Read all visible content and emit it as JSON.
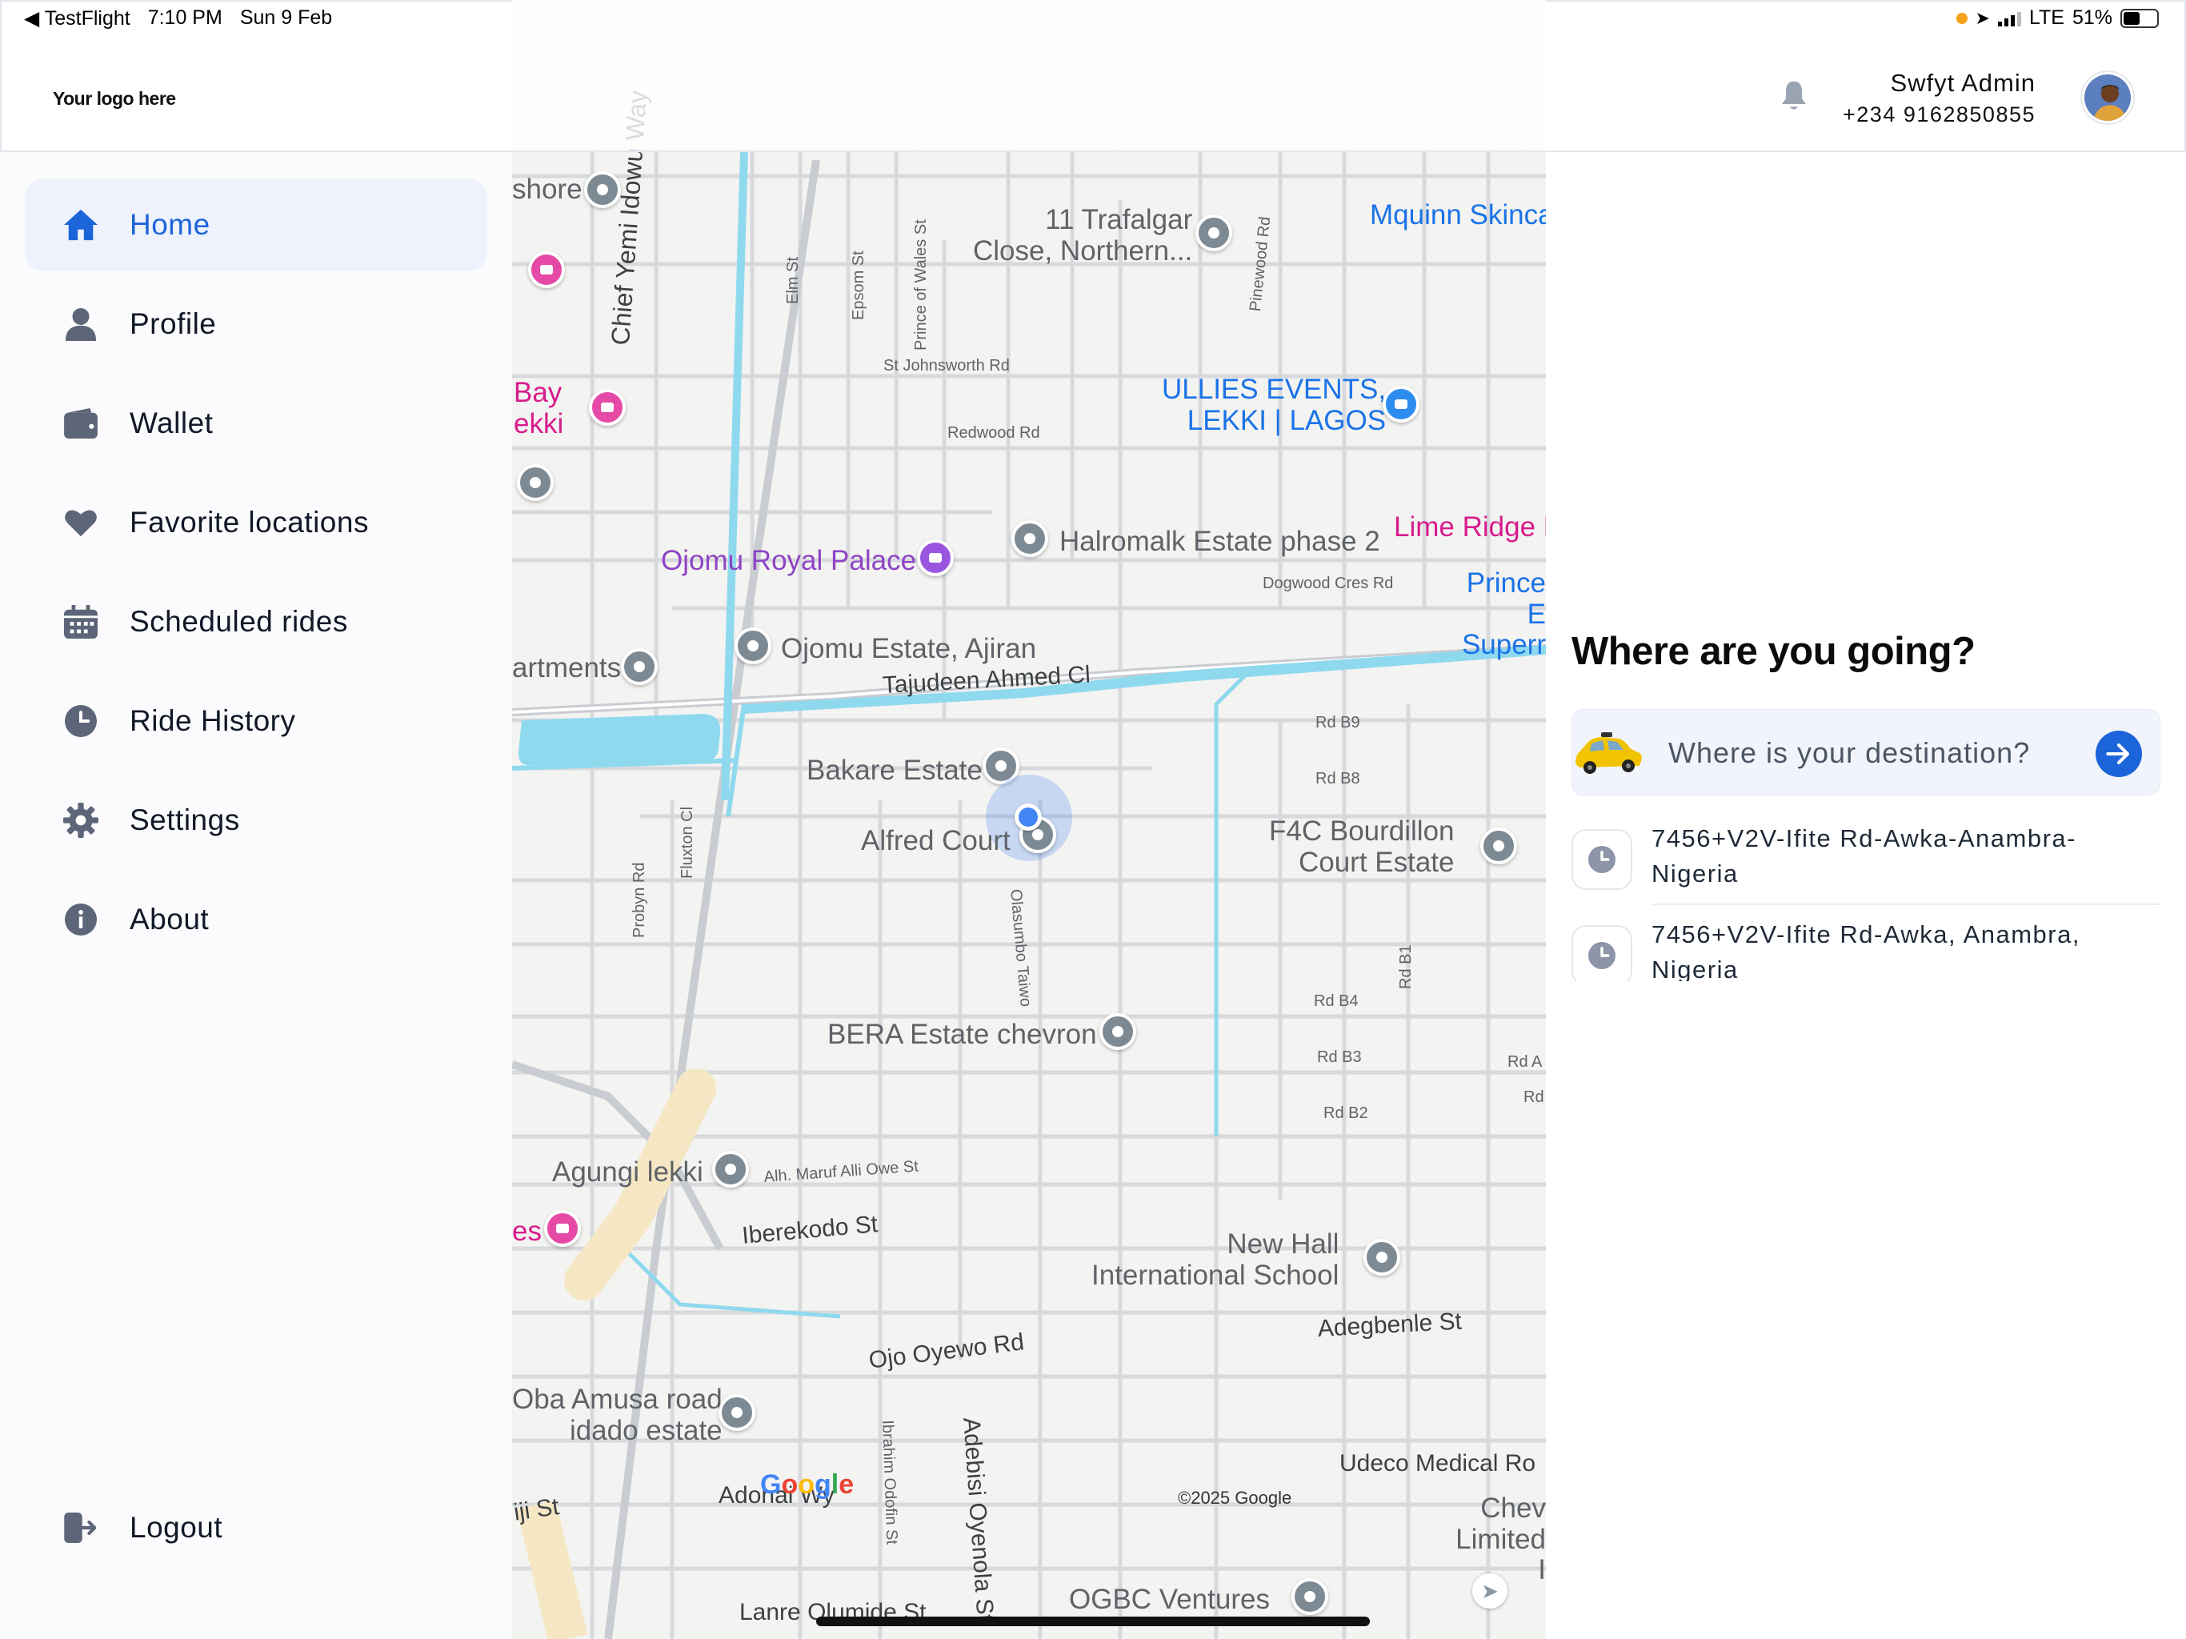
{
  "status_bar": {
    "back_app": "◀ TestFlight",
    "time": "7:10 PM",
    "date": "Sun 9 Feb",
    "network": "LTE",
    "battery": "51%",
    "battery_level": 0.51
  },
  "header": {
    "logo_text": "Your logo here",
    "user_name": "Swfyt Admin",
    "user_phone": "+234 9162850855"
  },
  "sidebar": {
    "items": [
      {
        "label": "Home",
        "icon": "home-icon",
        "active": true
      },
      {
        "label": "Profile",
        "icon": "user-icon",
        "active": false
      },
      {
        "label": "Wallet",
        "icon": "wallet-icon",
        "active": false
      },
      {
        "label": "Favorite locations",
        "icon": "heart-icon",
        "active": false
      },
      {
        "label": "Scheduled rides",
        "icon": "calendar-icon",
        "active": false
      },
      {
        "label": "Ride History",
        "icon": "clock-icon",
        "active": false
      },
      {
        "label": "Settings",
        "icon": "gear-icon",
        "active": false
      },
      {
        "label": "About",
        "icon": "info-icon",
        "active": false
      }
    ],
    "logout_label": "Logout"
  },
  "panel": {
    "title": "Where are you going?",
    "destination_placeholder": "Where is your destination?",
    "recent": [
      {
        "address": "7456+V2V-Ifite Rd-Awka-Anambra-Nigeria"
      },
      {
        "address": "7456+V2V-Ifite Rd-Awka, Anambra, Nigeria"
      }
    ]
  },
  "map": {
    "places": {
      "shore": "shore",
      "trafalgar": "11 Trafalgar\nClose, Northern...",
      "mquinn": "Mquinn Skinca",
      "bay": "Bay\nekki",
      "ullies": "ULLIES EVENTS,\nLEKKI | LAGOS",
      "lime": "Lime Ridge H",
      "halromalk": "Halromalk Estate phase 2",
      "ojomu_palace": "Ojomu Royal Palace",
      "prince": "Prince E\nSuperr",
      "apartments": "artments",
      "ojomu_estate": "Ojomu Estate, Ajiran",
      "bakare": "Bakare Estate",
      "alfred": "Alfred Court",
      "f4c": "F4C Bourdillon\nCourt Estate",
      "bera": "BERA Estate chevron",
      "agungi": "Agungi lekki",
      "es": "es",
      "newhall": "New Hall\nInternational School",
      "oba": "Oba Amusa road\nidado estate",
      "ogbc": "OGBC Ventures",
      "chev": "Chev\nLimited I"
    },
    "streets": {
      "yemi": "Chief Yemi Idowu Way",
      "elm": "Elm St",
      "epsom": "Epsom St",
      "wales": "Prince of Wales St",
      "pinewood": "Pinewood Rd",
      "johnsworth": "St Johnsworth Rd",
      "redwood": "Redwood Rd",
      "dogwood": "Dogwood Cres Rd",
      "tajudeen": "Tajudeen Ahmed Cl",
      "rdb9": "Rd B9",
      "rdb8": "Rd B8",
      "probyn": "Probyn Rd",
      "fluxton": "Fluxton Cl",
      "olasumbo": "Olasumbo Taiwo",
      "rdb4": "Rd B4",
      "rdb1": "Rd B1",
      "rdb3": "Rd B3",
      "rdb2": "Rd B2",
      "rda": "Rd A",
      "rd": "Rd",
      "maruf": "Alh. Maruf Alli Owe St",
      "iberekodo": "Iberekodo St",
      "ojo": "Ojo Oyewo Rd",
      "adegbenle": "Adegbenle St",
      "udeco": "Udeco Medical Ro",
      "adonai": "Adonai Wy",
      "odofin": "Ibrahim Odofin St",
      "oyenola": "Adebisi Oyenola St",
      "lanre": "Lanre Olumide St",
      "iji": "iji St"
    },
    "copyright": "©2025 Google",
    "google_logo": "Google"
  },
  "colors": {
    "accent": "#1c64d9",
    "active_bg": "#eef2fc",
    "map_bg": "#f3f3f1",
    "water": "#8fd9ef"
  }
}
